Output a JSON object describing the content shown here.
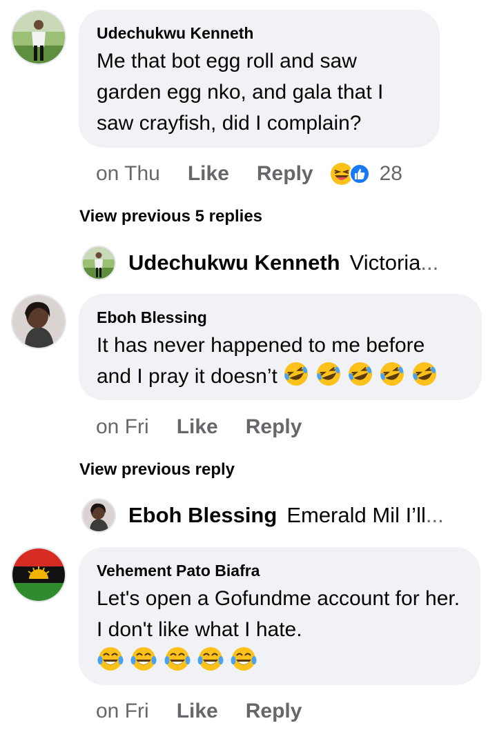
{
  "comments": [
    {
      "author": "Udechukwu Kenneth",
      "text": "Me that bot egg roll and saw garden egg nko,  and gala that I saw crayfish,  did I complain?",
      "time": "on Thu",
      "like_label": "Like",
      "reply_label": "Reply",
      "reaction_count": "28",
      "reaction_icons": [
        "laugh-emoji-icon",
        "like-thumb-icon"
      ]
    },
    {
      "author": "Eboh Blessing",
      "text": "It has never happened to me before and I pray it doesn’t",
      "emoji": "rolling-laugh-emoji-icon",
      "time": "on Fri",
      "like_label": "Like",
      "reply_label": "Reply"
    },
    {
      "author": "Vehement Pato Biafra",
      "text": "Let's open a Gofundme account for her. I don't like what I hate.",
      "emoji": "tears-of-joy-emoji-icon",
      "time": "on Fri",
      "like_label": "Like",
      "reply_label": "Reply"
    }
  ],
  "view_links": {
    "first": "View previous 5 replies",
    "second": "View previous reply"
  },
  "reply_previews": [
    {
      "author": "Udechukwu Kenneth",
      "snippet": "Victoria",
      "ellipsis": "..."
    },
    {
      "author": "Eboh Blessing",
      "snippet": "Emerald Mil I’ll",
      "ellipsis": "..."
    }
  ],
  "colors": {
    "bubble": "#f0f2f5",
    "meta": "#65676b",
    "like_blue": "#1877f2",
    "emoji_yellow": "#fcc21b"
  }
}
